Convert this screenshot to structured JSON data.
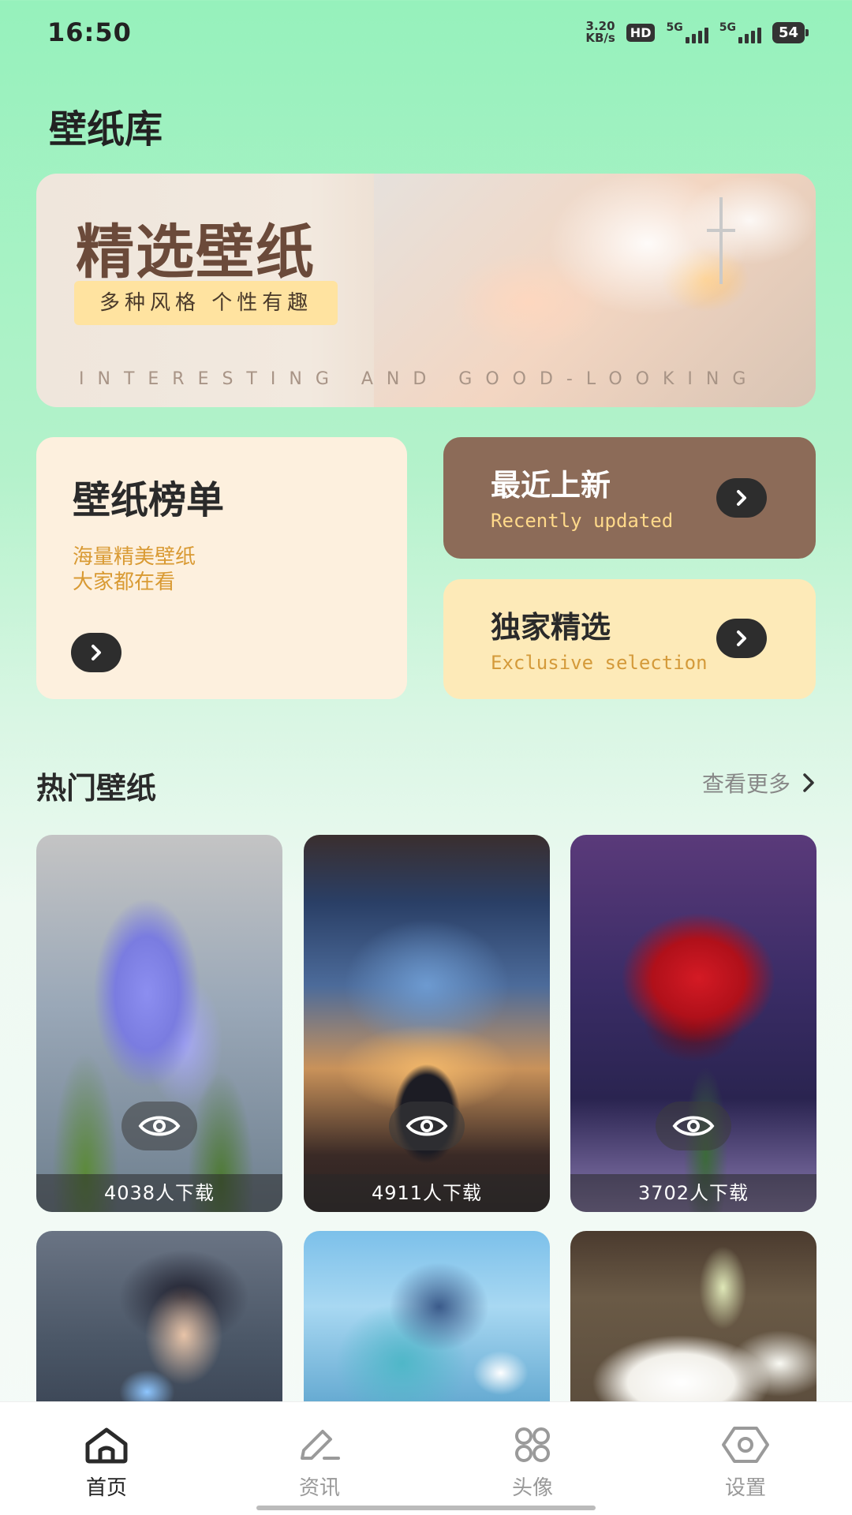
{
  "status_bar": {
    "time": "16:50",
    "net_speed_value": "3.20",
    "net_speed_unit": "KB/s",
    "hd_label": "HD",
    "sim1_label": "5G",
    "sim2_label": "5G",
    "battery": "54"
  },
  "page_title": "壁纸库",
  "banner": {
    "title": "精选壁纸",
    "tag": "多种风格 个性有趣",
    "subtitle": "INTERESTING AND GOOD-LOOKING"
  },
  "cards": {
    "ranking": {
      "title": "壁纸榜单",
      "desc_line1": "海量精美壁纸",
      "desc_line2": "大家都在看"
    },
    "recent": {
      "title": "最近上新",
      "subtitle": "Recently updated"
    },
    "exclusive": {
      "title": "独家精选",
      "subtitle": "Exclusive selection"
    }
  },
  "hot_section": {
    "title": "热门壁纸",
    "see_more": "查看更多"
  },
  "wallpapers": [
    {
      "downloads": "4038人下载",
      "subject": "hyacinth flower"
    },
    {
      "downloads": "4911人下载",
      "subject": "city night view"
    },
    {
      "downloads": "3702人下载",
      "subject": "red rose"
    },
    {
      "subject": "anime girl"
    },
    {
      "subject": "anime character"
    },
    {
      "subject": "white lily"
    }
  ],
  "tab_bar": {
    "tabs": [
      {
        "label": "首页",
        "icon": "home-icon",
        "active": true
      },
      {
        "label": "资讯",
        "icon": "edit-icon",
        "active": false
      },
      {
        "label": "头像",
        "icon": "grid-icon",
        "active": false
      },
      {
        "label": "设置",
        "icon": "settings-icon",
        "active": false
      }
    ]
  },
  "colors": {
    "bg_top": "#96f1bc",
    "recent_card": "#8c6b58",
    "ranking_card": "#fdf0de",
    "exclusive_card": "#fdeab8",
    "accent_orange": "#d99a33"
  }
}
